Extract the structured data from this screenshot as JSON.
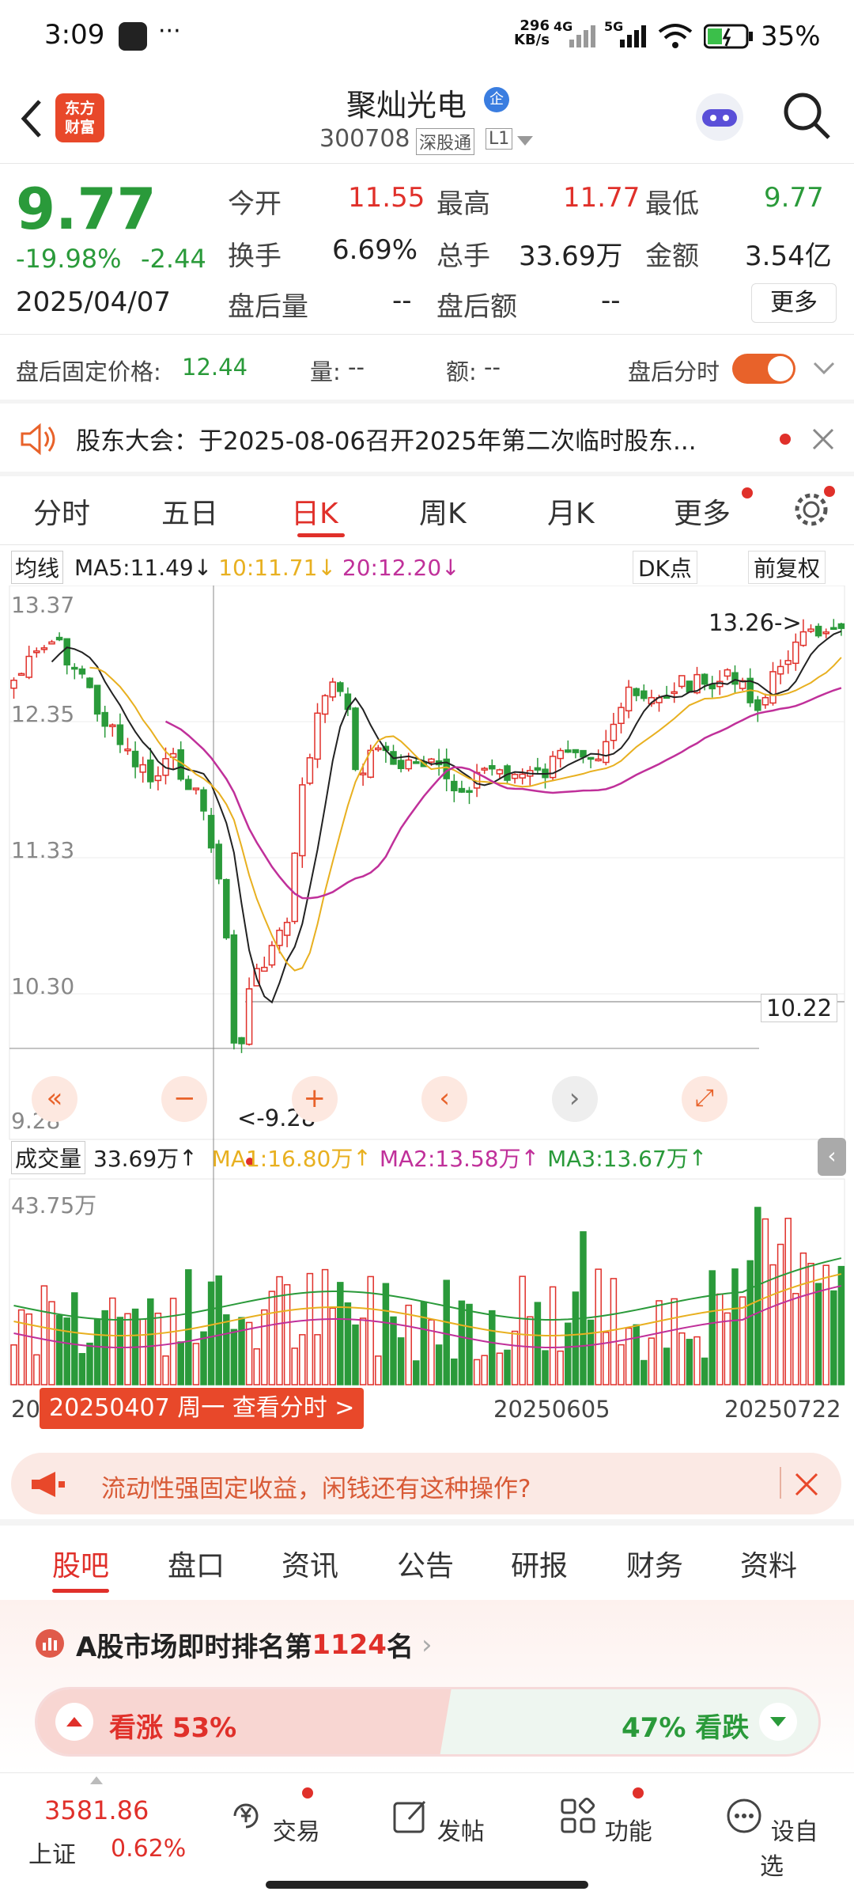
{
  "status_bar": {
    "time": "3:09",
    "net_speed_top": "296",
    "net_speed_bottom": "KB/s",
    "net_4g": "4G",
    "net_5g": "5G",
    "battery": "35%"
  },
  "header": {
    "brand_line1": "东方",
    "brand_line2": "财富",
    "stock_name": "聚灿光电",
    "badge": "企",
    "stock_code": "300708",
    "exchange_tag": "深股通",
    "level_tag": "L1"
  },
  "quote": {
    "price": "9.77",
    "change_pct": "-19.98%",
    "change": "-2.44",
    "date": "2025/04/07",
    "open_label": "今开",
    "open": "11.55",
    "high_label": "最高",
    "high": "11.77",
    "low_label": "最低",
    "low": "9.77",
    "turnover_label": "换手",
    "turnover": "6.69%",
    "volume_label": "总手",
    "volume": "33.69万",
    "amount_label": "金额",
    "amount": "3.54亿",
    "after_vol_label": "盘后量",
    "after_vol": "--",
    "after_amt_label": "盘后额",
    "after_amt": "--",
    "more_button": "更多"
  },
  "after_hours": {
    "fixed_price_label": "盘后固定价格:",
    "fixed_price": "12.44",
    "vol_label": "量:",
    "vol": "--",
    "amt_label": "额:",
    "amt": "--",
    "timeshare_label": "盘后分时"
  },
  "notice": {
    "text": "股东大会：于2025-08-06召开2025年第二次临时股东..."
  },
  "chart_tabs": [
    "分时",
    "五日",
    "日K",
    "周K",
    "月K",
    "更多"
  ],
  "chart_tabs_active": 2,
  "kline": {
    "ma_type": "均线",
    "ma5": "MA5:11.49",
    "ma10": "10:11.71",
    "ma20": "20:12.20",
    "dk_button": "DK点",
    "adjust_button": "前复权",
    "price_ticks": [
      "13.37",
      "12.35",
      "11.33",
      "10.30",
      "9.28"
    ],
    "high_marker": "13.26->",
    "low_marker": "<-9.28",
    "crosshair_price": "10.22",
    "vol_label": "成交量",
    "vol_value": "33.69万",
    "vol_ma1": "MA1:16.80万",
    "vol_ma2": "MA2:13.58万",
    "vol_ma3": "MA3:13.67万",
    "vol_max": "43.75万",
    "date_left": "20",
    "date_mid": "20250605",
    "date_right": "20250722",
    "date_popup": "20250407 周一 查看分时 >",
    "colors": {
      "up": "#e0302a",
      "down": "#2a9a3a",
      "ma5": "#222222",
      "ma10": "#e8b020",
      "ma20": "#c0309a"
    }
  },
  "ad": {
    "text": "流动性强固定收益，闲钱还有这种操作?"
  },
  "sub_tabs": [
    "股吧",
    "盘口",
    "资讯",
    "公告",
    "研报",
    "财务",
    "资料"
  ],
  "rank": {
    "prefix": "A股市场即时排名第",
    "rank": "1124",
    "suffix": "名",
    "bull_label": "看涨 53%",
    "bear_label": "47% 看跌",
    "bull_pct": 53
  },
  "bottom_nav": {
    "index_value": "3581.86",
    "index_name": "上证",
    "index_change": "0.62%",
    "items": [
      {
        "label": "交易",
        "icon": "yen-refresh-icon"
      },
      {
        "label": "发帖",
        "icon": "edit-icon"
      },
      {
        "label": "功能",
        "icon": "grid-icon"
      },
      {
        "label": "设自选",
        "icon": "more-circle-icon"
      }
    ]
  }
}
